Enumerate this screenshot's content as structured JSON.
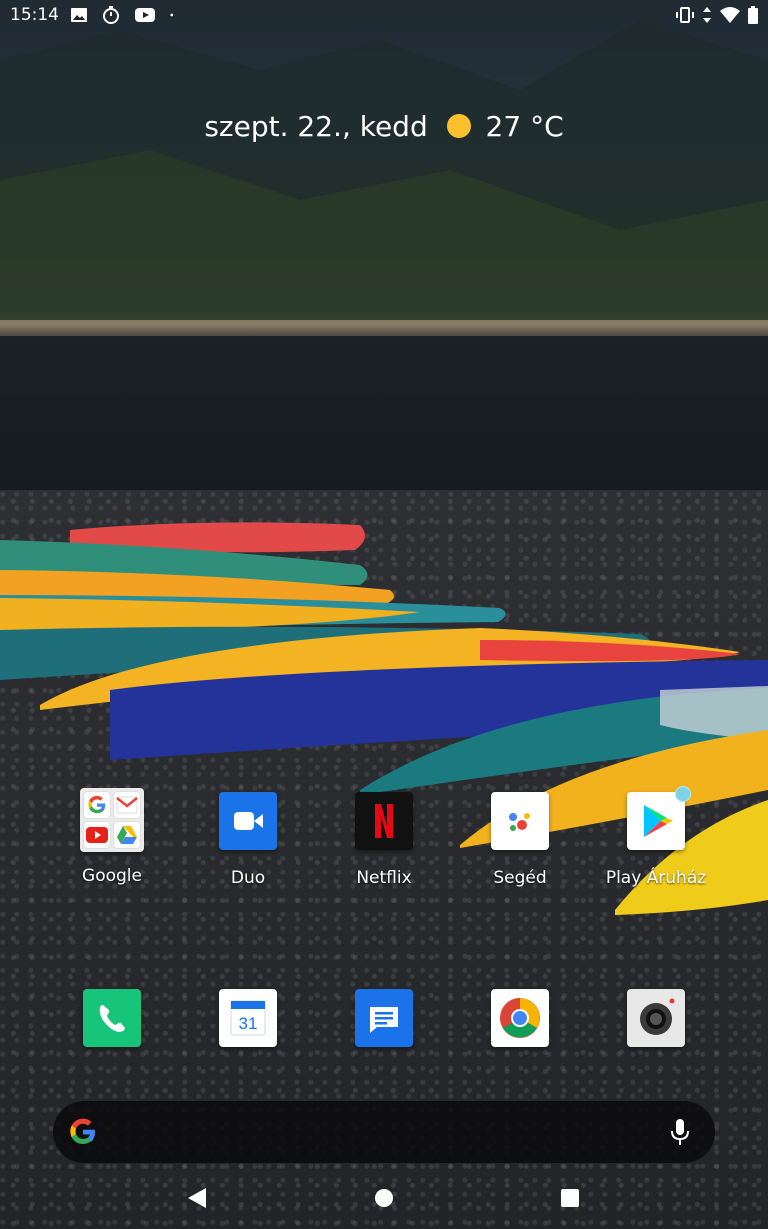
{
  "status_bar": {
    "time": "15:14",
    "left_icons": [
      "image-icon",
      "timer-icon",
      "youtube-icon",
      "dot-icon"
    ],
    "right_icons": [
      "vibrate-icon",
      "data-arrows-icon",
      "wifi-icon",
      "battery-icon"
    ]
  },
  "glance": {
    "date": "szept. 22., kedd",
    "weather_icon": "sun-icon",
    "temperature": "27 °C"
  },
  "apps_row1": [
    {
      "label": "Google",
      "icon": "google-folder-icon"
    },
    {
      "label": "Duo",
      "icon": "duo-icon"
    },
    {
      "label": "Netflix",
      "icon": "netflix-icon"
    },
    {
      "label": "Segéd",
      "icon": "assistant-icon"
    },
    {
      "label": "Play Áruház",
      "icon": "play-store-icon"
    }
  ],
  "dock": [
    {
      "icon": "phone-icon"
    },
    {
      "icon": "calendar-icon",
      "text": "31"
    },
    {
      "icon": "messages-icon"
    },
    {
      "icon": "chrome-icon"
    },
    {
      "icon": "camera-icon"
    }
  ],
  "search": {
    "g_icon": "google-g-icon",
    "mic_icon": "mic-icon"
  },
  "nav": {
    "icons": [
      "back-icon",
      "home-icon",
      "recents-icon"
    ]
  },
  "colors": {
    "sun": "#fbc02d",
    "phone": "#16c47a",
    "duo": "#1a73e8",
    "messages": "#1a73e8",
    "notification_dot": "#7fd3e8"
  }
}
